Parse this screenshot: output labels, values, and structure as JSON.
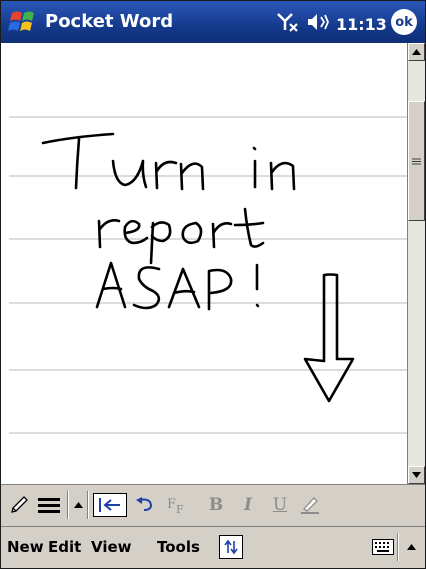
{
  "titlebar": {
    "app_title": "Pocket Word",
    "clock": "11:13",
    "ok_label": "ok",
    "colors": {
      "bar": "#173d90",
      "text": "#ffffff"
    }
  },
  "document": {
    "handwriting_lines": [
      "Turn in",
      "report",
      "ASAP!"
    ],
    "ruled_paper": true
  },
  "toolbar": {
    "items": [
      "pen-icon",
      "line-width-icon",
      "chevron-up-icon",
      "indent-tool-icon",
      "undo-icon",
      "font-icon",
      "bold-icon",
      "italic-icon",
      "underline-icon",
      "highlight-icon"
    ],
    "bold_label": "B",
    "italic_label": "I",
    "underline_label": "U"
  },
  "menubar": {
    "menus": [
      "New",
      "Edit",
      "View",
      "Tools"
    ]
  }
}
